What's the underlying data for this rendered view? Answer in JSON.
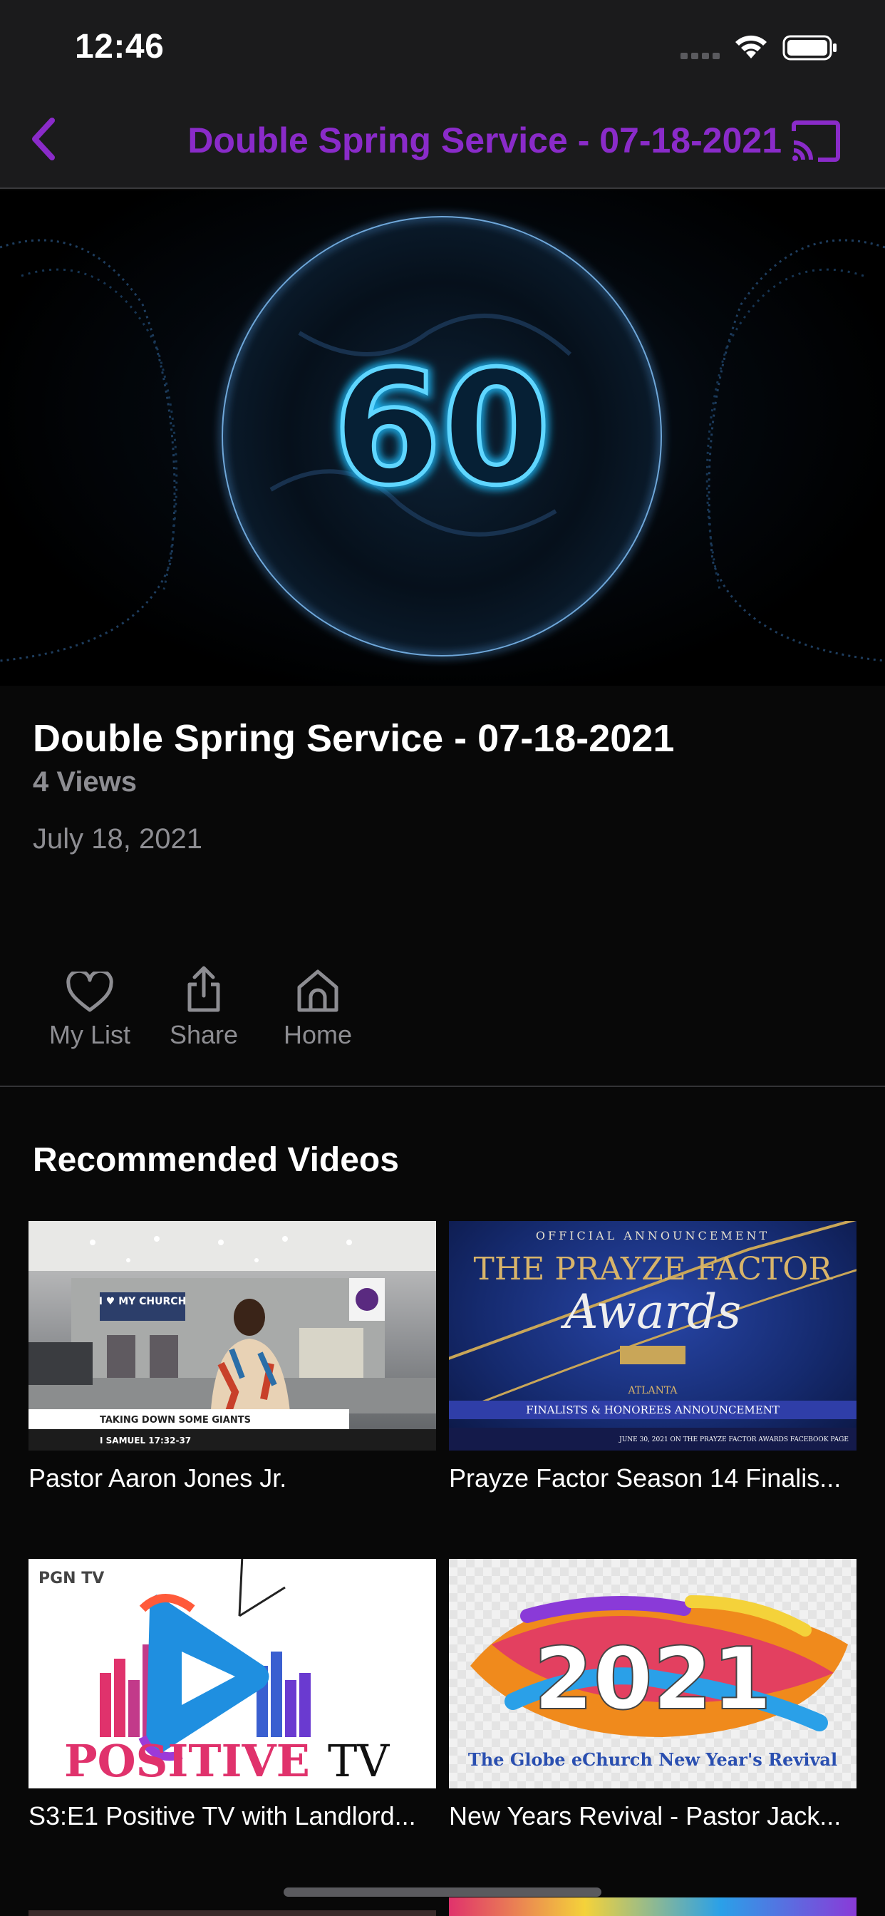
{
  "status": {
    "time": "12:46"
  },
  "nav": {
    "title": "Double Spring Service - 07-18-2021",
    "back_icon": "chevron-left-icon",
    "cast_icon": "cast-icon"
  },
  "colors": {
    "accent": "#8a2bc9",
    "background": "#080808",
    "secondary_text": "#8d8d92"
  },
  "hero": {
    "counter": "60"
  },
  "video": {
    "title": "Double Spring Service - 07-18-2021",
    "views": "4 Views",
    "date": "July 18, 2021"
  },
  "actions": [
    {
      "label": "My List",
      "icon": "heart-icon"
    },
    {
      "label": "Share",
      "icon": "share-icon"
    },
    {
      "label": "Home",
      "icon": "home-icon"
    }
  ],
  "recommended": {
    "title": "Recommended Videos",
    "items": [
      {
        "title": "Pastor Aaron Jones Jr.",
        "thumb": {
          "banner": "I ♥ MY CHURCH",
          "caption": "TAKING DOWN SOME GIANTS",
          "subcaption": "I SAMUEL 17:32-37"
        }
      },
      {
        "title": "Prayze Factor Season 14 Finalis...",
        "thumb": {
          "top": "OFFICIAL ANNOUNCEMENT",
          "headline": "THE PRAYZE FACTOR",
          "script": "Awards",
          "city": "ATLANTA",
          "strip": "FINALISTS & HONOREES ANNOUNCEMENT",
          "footer": "JUNE 30, 2021 ON THE PRAYZE FACTOR AWARDS FACEBOOK PAGE"
        }
      },
      {
        "title": "S3:E1 Positive TV with Landlord...",
        "thumb": {
          "brand": "PGN TV",
          "logo_a": "POSITIVE",
          "logo_b": "TV"
        }
      },
      {
        "title": "New Years Revival - Pastor Jack...",
        "thumb": {
          "year": "2021",
          "subtitle": "The Globe eChurch New Year's Revival"
        }
      }
    ]
  }
}
